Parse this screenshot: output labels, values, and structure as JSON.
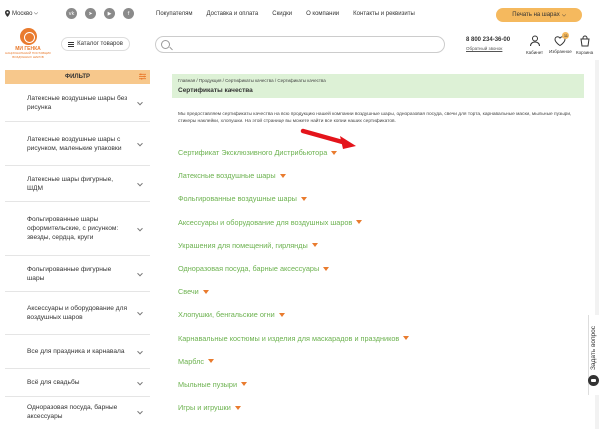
{
  "topbar": {
    "city": "Москво",
    "nav": [
      "Покупателям",
      "Доставка и оплата",
      "Скидки",
      "О компании",
      "Контакты и реквизиты"
    ],
    "print_label": "Печать на шарах"
  },
  "header": {
    "logo_name": "МИ ГЕНКА",
    "logo_sub": "НАЦИОНАЛЬНЫЙ ПОСТАВЩИК ВОЗДУШНЫХ ШАРОВ",
    "catalog_label": "Каталог товаров",
    "search_placeholder": "",
    "phone": "8 800 234-36-00",
    "callback": "Обратный звонок",
    "cabinet": "Кабинет",
    "favorites": "Избранное",
    "favorites_count": "11",
    "cart": "Корзина"
  },
  "sidebar": {
    "filter_title": "ФИЛЬТР",
    "items": [
      "Латексные воздушные шары без рисунка",
      "Латексные воздушные шары с рисунком, маленькие упаковки",
      "Латексные шары фигурные, ШДМ",
      "Фольгированные шары оформительские, с рисунком: звезды, сердца, круги",
      "Фольгированные фигурные шары",
      "Аксессуары и оборудование для воздушных шаров",
      "Все для праздника и карнавала",
      "Всё для свадьбы",
      "Одноразовая посуда, барные аксессуары"
    ]
  },
  "main": {
    "breadcrumbs": "Главная / Продукция / Сертификаты качества / Сертификаты качества",
    "title": "Сертификаты качества",
    "intro": "Мы предоставляем сертификаты качества на всю продукцию нашей компании воздушные шары, одноразовая посуда, свечи для торта, карнавальные маски, мыльные пузыри, стикеры наклейки, хлопушки. На этой странице вы можете найти все копии наших сертификатов.",
    "categories": [
      "Сертификат Эксклюзивного Дистрибьютора",
      "Латексные воздушные шары",
      "Фольгированные воздушные шары",
      "Аксессуары и оборудование для воздушных шаров",
      "Украшения для помещений, гирлянды",
      "Одноразовая посуда, барные аксессуары",
      "Свечи",
      "Хлопушки, бенгальские огни",
      "Карнавальные костюмы и изделия для маскарадов и праздников",
      "Марблс",
      "Мыльные пузыри",
      "Игры и игрушки"
    ]
  },
  "ask_question": "Задать вопрос",
  "colors": {
    "accent_orange": "#e97b2e",
    "category_green": "#6cb24f",
    "filter_bg": "#f7c88c",
    "breadcrumb_bg": "#ddf1d6"
  }
}
